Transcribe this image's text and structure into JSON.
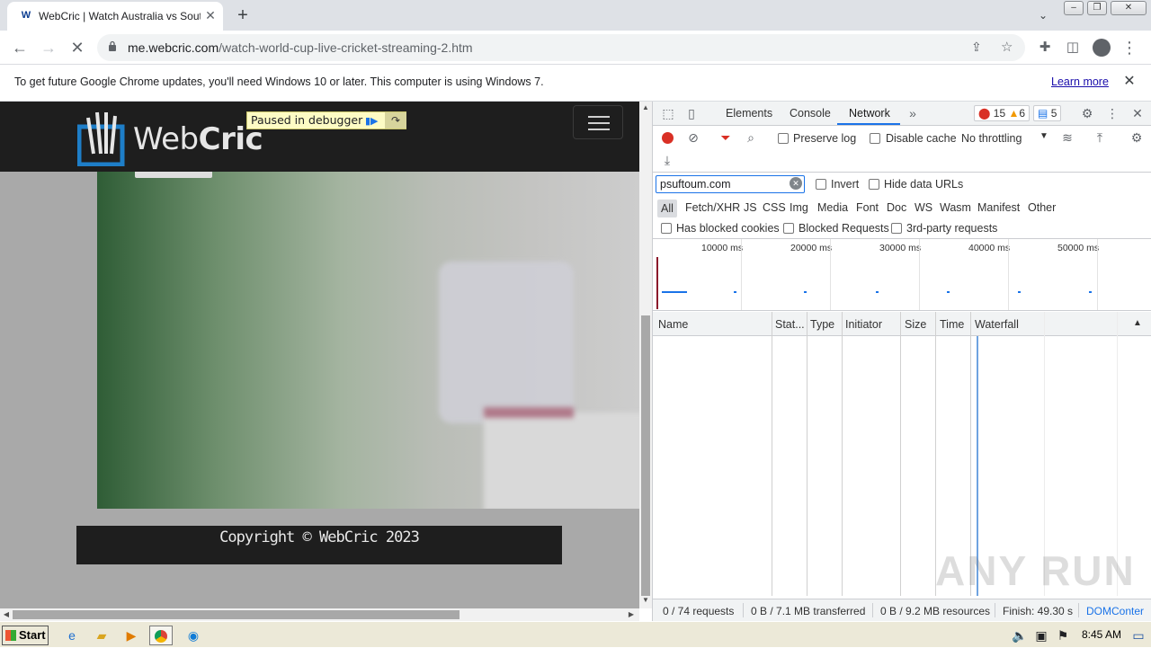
{
  "browser": {
    "tab_title": "WebCric | Watch Australia vs South",
    "tab_favicon": "W",
    "new_tab": "+",
    "url_host": "me.webcric.com",
    "url_path": "/watch-world-cup-live-cricket-streaming-2.htm"
  },
  "infobar": {
    "message": "To get future Google Chrome updates, you'll need Windows 10 or later. This computer is using Windows 7.",
    "learn_more": "Learn more"
  },
  "page": {
    "logo_text_light": "Web",
    "logo_text_bold": "Cric",
    "paused_label": "Paused in debugger",
    "footer": "Copyright © WebCric 2023"
  },
  "devtools": {
    "tabs": [
      "Elements",
      "Console",
      "Network"
    ],
    "errors_count": "15",
    "warnings_count": "6",
    "messages_count": "5",
    "preserve_log": "Preserve log",
    "disable_cache": "Disable cache",
    "throttling": "No throttling",
    "filter_value": "psuftoum.com",
    "invert": "Invert",
    "hide_data_urls": "Hide data URLs",
    "type_filters": [
      "All",
      "Fetch/XHR",
      "JS",
      "CSS",
      "Img",
      "Media",
      "Font",
      "Doc",
      "WS",
      "Wasm",
      "Manifest",
      "Other"
    ],
    "has_blocked_cookies": "Has blocked cookies",
    "blocked_requests": "Blocked Requests",
    "third_party": "3rd-party requests",
    "overview_labels": [
      "10000 ms",
      "20000 ms",
      "30000 ms",
      "40000 ms",
      "50000 ms"
    ],
    "columns": [
      "Name",
      "Stat...",
      "Type",
      "Initiator",
      "Size",
      "Time",
      "Waterfall"
    ],
    "status": {
      "requests": "0 / 74 requests",
      "transferred": "0 B / 7.1 MB transferred",
      "resources": "0 B / 9.2 MB resources",
      "finish": "Finish: 49.30 s",
      "domcontent": "DOMConter"
    }
  },
  "taskbar": {
    "start": "Start",
    "clock": "8:45 AM"
  },
  "watermark": "ANY RUN"
}
